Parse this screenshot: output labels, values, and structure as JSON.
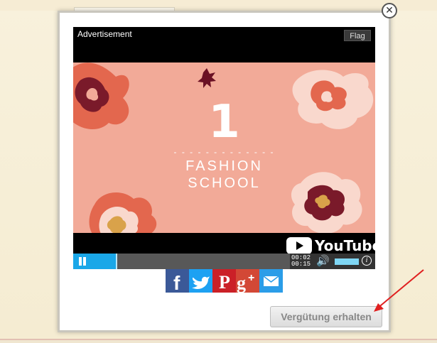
{
  "modal": {
    "close_glyph": "✕",
    "ad": {
      "label": "Advertisement",
      "flag_label": "Flag",
      "video": {
        "number": "1",
        "dashes": "- - - - - - - - - - - - -",
        "title_line1": "FASHION",
        "title_line2": "SCHOOL",
        "brand": "YouTube"
      },
      "controls": {
        "elapsed": "00:02",
        "duration": "00:15",
        "progress_fraction": 0.2,
        "volume_fraction": 1.0
      }
    },
    "share_icons": [
      "facebook-icon",
      "twitter-icon",
      "pinterest-icon",
      "google-plus-icon",
      "email-icon"
    ],
    "reward_button_label": "Vergütung erhalten"
  },
  "colors": {
    "progress": "#1aa7e8",
    "video_bg": "#f2aa98",
    "facebook": "#3b5998",
    "twitter": "#1da1f2",
    "pinterest": "#cb2027",
    "google_plus": "#d34836",
    "email": "#2b9de8",
    "annotation_arrow": "#e02020"
  }
}
